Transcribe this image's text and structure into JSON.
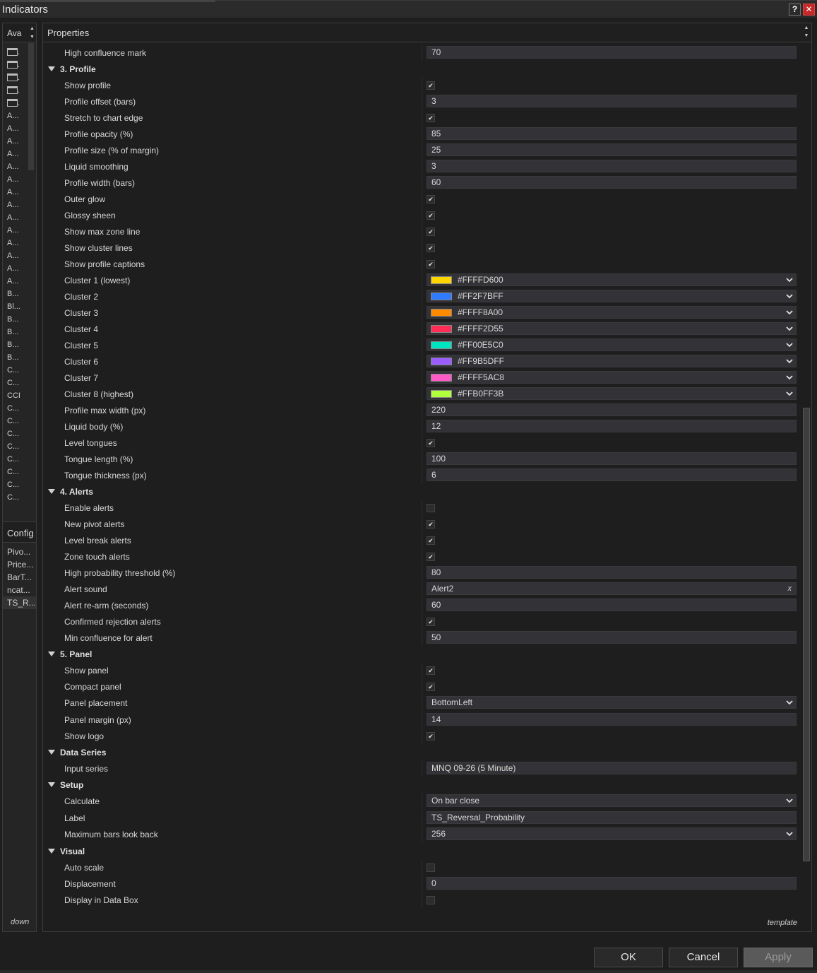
{
  "window": {
    "title": "Indicators",
    "help_label": "?",
    "close_label": "✕"
  },
  "left_panel": {
    "header": "Ava",
    "items": [
      {
        "icon": "folder",
        "label": "."
      },
      {
        "icon": "folder",
        "label": "."
      },
      {
        "icon": "folder",
        "label": "."
      },
      {
        "icon": "folder",
        "label": "."
      },
      {
        "icon": "folder",
        "label": "."
      },
      {
        "label": "A..."
      },
      {
        "label": "A..."
      },
      {
        "label": "A..."
      },
      {
        "label": "A..."
      },
      {
        "label": "A..."
      },
      {
        "label": "A..."
      },
      {
        "label": "A..."
      },
      {
        "label": "A..."
      },
      {
        "label": "A..."
      },
      {
        "label": "A..."
      },
      {
        "label": "A..."
      },
      {
        "label": "A..."
      },
      {
        "label": "A..."
      },
      {
        "label": "A..."
      },
      {
        "label": "B..."
      },
      {
        "label": "Bl..."
      },
      {
        "label": "B..."
      },
      {
        "label": "B..."
      },
      {
        "label": "B..."
      },
      {
        "label": "B..."
      },
      {
        "label": "C..."
      },
      {
        "label": "C..."
      },
      {
        "label": "CCI"
      },
      {
        "label": "C..."
      },
      {
        "label": "C..."
      },
      {
        "label": "C..."
      },
      {
        "label": "C..."
      },
      {
        "label": "C..."
      },
      {
        "label": "C..."
      },
      {
        "label": "C..."
      },
      {
        "label": "C..."
      }
    ],
    "config_header": "Config",
    "config_items": [
      "Pivo...",
      "Price...",
      "BarT...",
      "ncat...",
      "TS_R..."
    ],
    "down_label": "down"
  },
  "properties": {
    "header": "Properties",
    "template_label": "template",
    "rows": [
      {
        "type": "text",
        "name": "High confluence mark",
        "value": "70"
      },
      {
        "type": "category",
        "name": "3. Profile"
      },
      {
        "type": "check",
        "name": "Show profile",
        "checked": true
      },
      {
        "type": "text",
        "name": "Profile offset (bars)",
        "value": "3"
      },
      {
        "type": "check",
        "name": "Stretch to chart edge",
        "checked": true
      },
      {
        "type": "text",
        "name": "Profile opacity (%)",
        "value": "85"
      },
      {
        "type": "text",
        "name": "Profile size (% of margin)",
        "value": "25"
      },
      {
        "type": "text",
        "name": "Liquid smoothing",
        "value": "3"
      },
      {
        "type": "text",
        "name": "Profile width (bars)",
        "value": "60"
      },
      {
        "type": "check",
        "name": "Outer glow",
        "checked": true
      },
      {
        "type": "check",
        "name": "Glossy sheen",
        "checked": true
      },
      {
        "type": "check",
        "name": "Show max zone line",
        "checked": true
      },
      {
        "type": "check",
        "name": "Show cluster lines",
        "checked": true
      },
      {
        "type": "check",
        "name": "Show profile captions",
        "checked": true
      },
      {
        "type": "color",
        "name": "Cluster 1 (lowest)",
        "value": "#FFFFD600",
        "color": "#FFD600"
      },
      {
        "type": "color",
        "name": "Cluster 2",
        "value": "#FF2F7BFF",
        "color": "#2F7BFF"
      },
      {
        "type": "color",
        "name": "Cluster 3",
        "value": "#FFFF8A00",
        "color": "#FF8A00"
      },
      {
        "type": "color",
        "name": "Cluster 4",
        "value": "#FFFF2D55",
        "color": "#FF2D55"
      },
      {
        "type": "color",
        "name": "Cluster 5",
        "value": "#FF00E5C0",
        "color": "#00E5C0"
      },
      {
        "type": "color",
        "name": "Cluster 6",
        "value": "#FF9B5DFF",
        "color": "#9B5DFF"
      },
      {
        "type": "color",
        "name": "Cluster 7",
        "value": "#FFFF5AC8",
        "color": "#FF5AC8"
      },
      {
        "type": "color",
        "name": "Cluster 8 (highest)",
        "value": "#FFB0FF3B",
        "color": "#B0FF3B"
      },
      {
        "type": "text",
        "name": "Profile max width (px)",
        "value": "220"
      },
      {
        "type": "text",
        "name": "Liquid body (%)",
        "value": "12"
      },
      {
        "type": "check",
        "name": "Level tongues",
        "checked": true
      },
      {
        "type": "text",
        "name": "Tongue length (%)",
        "value": "100"
      },
      {
        "type": "text",
        "name": "Tongue thickness (px)",
        "value": "6"
      },
      {
        "type": "category",
        "name": "4. Alerts"
      },
      {
        "type": "check",
        "name": "Enable alerts",
        "checked": false
      },
      {
        "type": "check",
        "name": "New pivot alerts",
        "checked": true
      },
      {
        "type": "check",
        "name": "Level break alerts",
        "checked": true
      },
      {
        "type": "check",
        "name": "Zone touch alerts",
        "checked": true
      },
      {
        "type": "text",
        "name": "High probability threshold (%)",
        "value": "80"
      },
      {
        "type": "sound",
        "name": "Alert sound",
        "value": "Alert2",
        "clear": "x"
      },
      {
        "type": "text",
        "name": "Alert re-arm (seconds)",
        "value": "60"
      },
      {
        "type": "check",
        "name": "Confirmed rejection alerts",
        "checked": true
      },
      {
        "type": "text",
        "name": "Min confluence for alert",
        "value": "50"
      },
      {
        "type": "category",
        "name": "5. Panel"
      },
      {
        "type": "check",
        "name": "Show panel",
        "checked": true
      },
      {
        "type": "check",
        "name": "Compact panel",
        "checked": true
      },
      {
        "type": "select",
        "name": "Panel placement",
        "value": "BottomLeft"
      },
      {
        "type": "text",
        "name": "Panel margin (px)",
        "value": "14"
      },
      {
        "type": "check",
        "name": "Show logo",
        "checked": true
      },
      {
        "type": "category",
        "name": "Data Series"
      },
      {
        "type": "text",
        "name": "Input series",
        "value": "MNQ 09-26 (5 Minute)"
      },
      {
        "type": "category",
        "name": "Setup"
      },
      {
        "type": "select",
        "name": "Calculate",
        "value": "On bar close"
      },
      {
        "type": "text",
        "name": "Label",
        "value": "TS_Reversal_Probability"
      },
      {
        "type": "select",
        "name": "Maximum bars look back",
        "value": "256"
      },
      {
        "type": "category",
        "name": "Visual"
      },
      {
        "type": "check",
        "name": "Auto scale",
        "checked": false
      },
      {
        "type": "text",
        "name": "Displacement",
        "value": "0"
      },
      {
        "type": "check",
        "name": "Display in Data Box",
        "checked": false
      }
    ]
  },
  "footer": {
    "ok": "OK",
    "cancel": "Cancel",
    "apply": "Apply"
  }
}
